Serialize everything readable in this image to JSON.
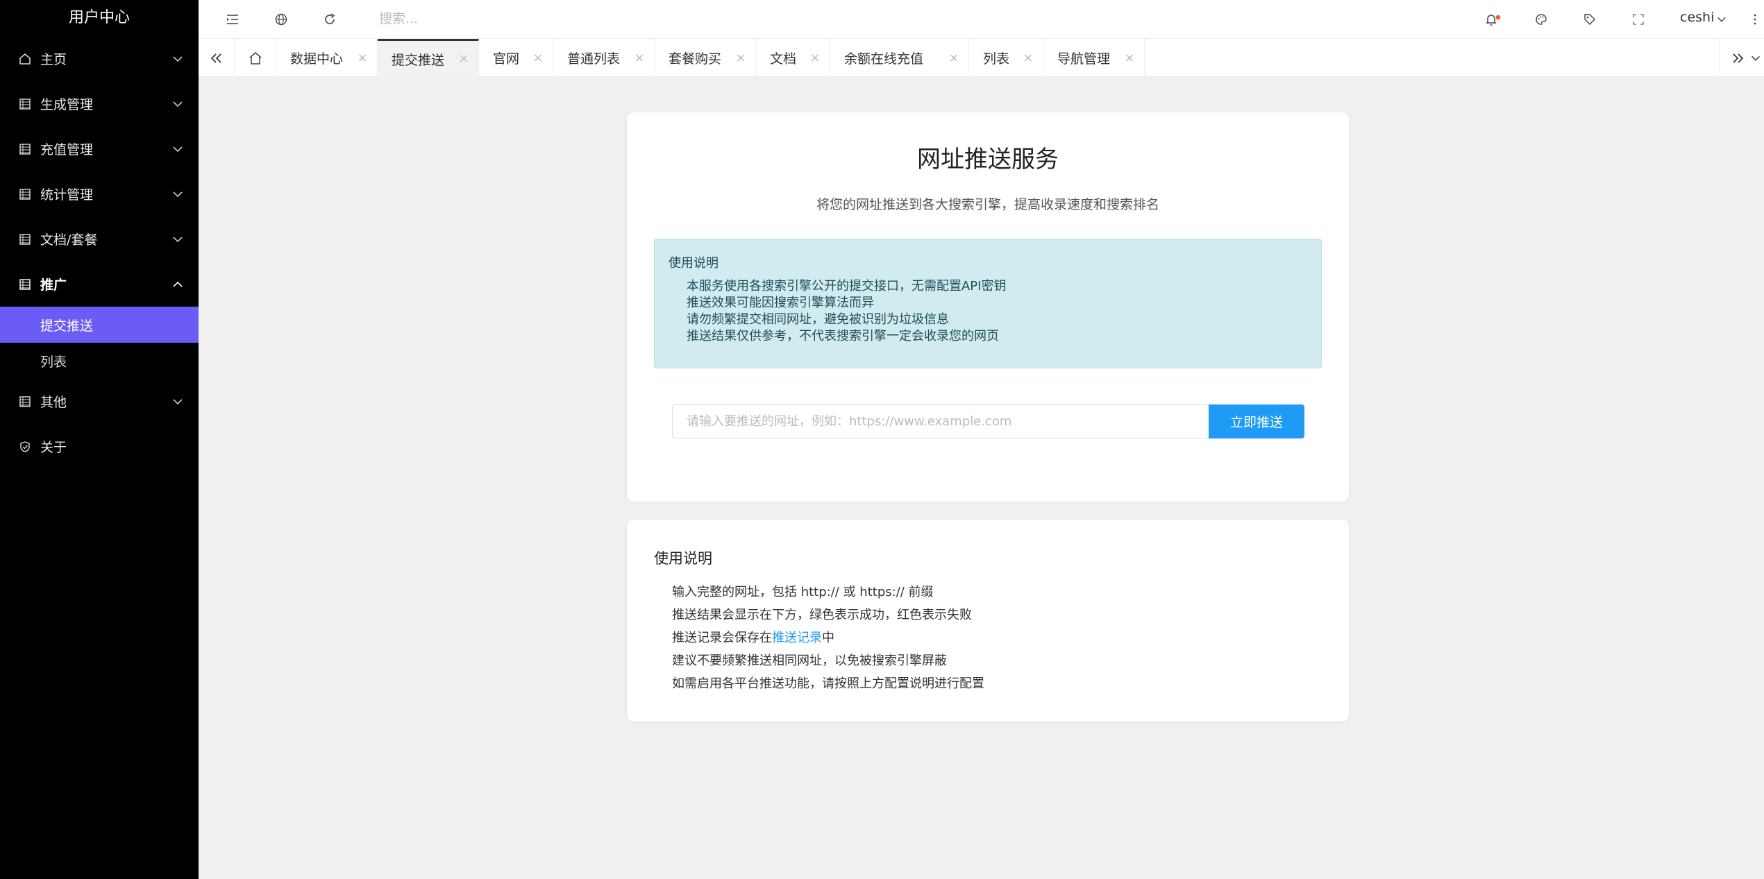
{
  "sidebar": {
    "brand": "用户中心",
    "items": [
      {
        "label": "主页",
        "icon": "home-icon",
        "expanded": false
      },
      {
        "label": "生成管理",
        "icon": "grid-icon",
        "expanded": false
      },
      {
        "label": "充值管理",
        "icon": "grid-icon",
        "expanded": false
      },
      {
        "label": "统计管理",
        "icon": "grid-icon",
        "expanded": false
      },
      {
        "label": "文档/套餐",
        "icon": "grid-icon",
        "expanded": false
      },
      {
        "label": "推广",
        "icon": "grid-icon",
        "expanded": true
      },
      {
        "label": "其他",
        "icon": "grid-icon",
        "expanded": false
      },
      {
        "label": "关于",
        "icon": "shield-check-icon",
        "expanded": false
      }
    ],
    "submenu": [
      {
        "label": "提交推送",
        "active": true
      },
      {
        "label": "列表",
        "active": false
      }
    ],
    "active_color": "#6b5cf6"
  },
  "header": {
    "search_placeholder": "搜索...",
    "user_name": "ceshi",
    "notification_dot_color": "#ff5722"
  },
  "tabs": [
    {
      "label": "数据中心",
      "active": false
    },
    {
      "label": "提交推送",
      "active": true
    },
    {
      "label": "官网",
      "active": false
    },
    {
      "label": "普通列表",
      "active": false
    },
    {
      "label": "套餐购买",
      "active": false
    },
    {
      "label": "文档",
      "active": false
    },
    {
      "label": "余额在线充值",
      "active": false
    },
    {
      "label": "列表",
      "active": false
    },
    {
      "label": "导航管理",
      "active": false
    }
  ],
  "tab_close_glyph": "×",
  "main": {
    "title": "网址推送服务",
    "subtitle": "将您的网址推送到各大搜索引擎，提高收录速度和搜索排名",
    "notice": {
      "title": "使用说明",
      "items": [
        "本服务使用各搜索引擎公开的提交接口，无需配置API密钥",
        "推送效果可能因搜索引擎算法而异",
        "请勿频繁提交相同网址，避免被识别为垃圾信息",
        "推送结果仅供参考，不代表搜索引擎一定会收录您的网页"
      ]
    },
    "url_placeholder": "请输入要推送的网址，例如：https://www.example.com",
    "url_value": "",
    "push_button_label": "立即推送",
    "accent_color": "#1f9af5"
  },
  "help": {
    "title": "使用说明",
    "items": [
      "输入完整的网址，包括 http:// 或 https:// 前缀",
      "推送结果会显示在下方，绿色表示成功，红色表示失败"
    ],
    "record_prefix": "推送记录会保存在",
    "record_link": "推送记录",
    "record_suffix": "中",
    "items_after": [
      "建议不要频繁推送相同网址，以免被搜索引擎屏蔽",
      "如需启用各平台推送功能，请按照上方配置说明进行配置"
    ]
  }
}
